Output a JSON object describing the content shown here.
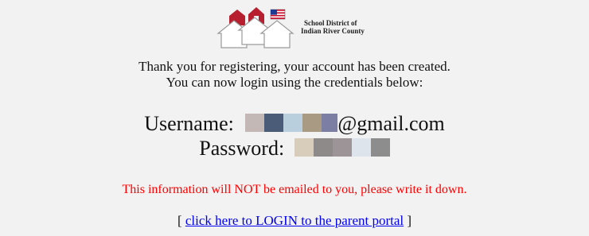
{
  "logo": {
    "line1": "School District of",
    "line2": "Indian River County",
    "flag_icon": "us-flag-icon",
    "houses_icon": "houses-logo-icon"
  },
  "message": {
    "line1": "Thank you for registering, your account has been created.",
    "line2": "You can now login using the credentials below:"
  },
  "credentials": {
    "username_label": "Username:",
    "username_suffix": "@gmail.com",
    "password_label": "Password:"
  },
  "warning": "This information will NOT be emailed to you, please write it down.",
  "login": {
    "bracket_open": "[",
    "link_text": "click here to LOGIN to the parent portal",
    "bracket_close": "]"
  },
  "colors": {
    "background": "#f2f2f2",
    "warning_red": "#ff0000",
    "link_blue": "#0000ee"
  }
}
